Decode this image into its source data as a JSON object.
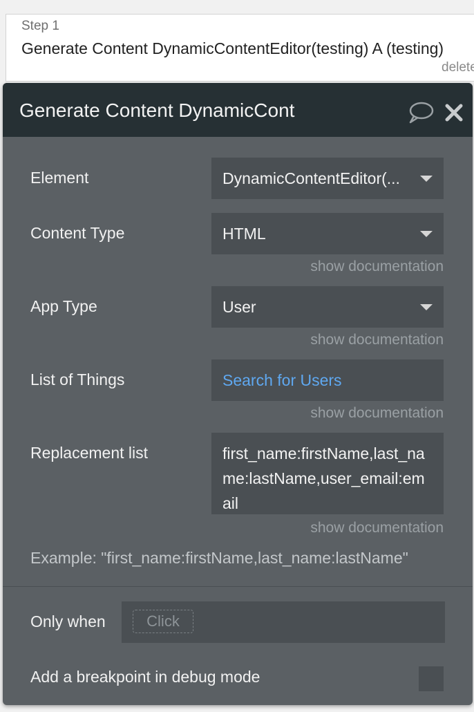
{
  "step": {
    "label": "Step 1",
    "title": "Generate Content DynamicContentEditor(testing) A (testing)",
    "delete_label": "delete"
  },
  "panel": {
    "title": "Generate Content DynamicCont",
    "header_bg": "#263034",
    "body_bg": "#5b6064",
    "field_bg": "#4a4f53",
    "link_color": "#5fa8f0"
  },
  "fields": {
    "element": {
      "label": "Element",
      "value": "DynamicContentEditor(..."
    },
    "content_type": {
      "label": "Content Type",
      "value": "HTML",
      "doc": "show documentation"
    },
    "app_type": {
      "label": "App Type",
      "value": "User",
      "doc": "show documentation"
    },
    "list_of_things": {
      "label": "List of Things",
      "value": "Search for Users",
      "doc": "show documentation"
    },
    "replacement_list": {
      "label": "Replacement list",
      "value": "first_name:firstName,last_name:lastName,user_email:email",
      "doc": "show documentation"
    }
  },
  "example": "Example: \"first_name:firstName,last_name:lastName\"",
  "only_when": {
    "label": "Only when",
    "placeholder": "Click"
  },
  "breakpoint": {
    "label": "Add a breakpoint in debug mode",
    "checked": false
  },
  "icons": {
    "comment": "comment-icon",
    "close": "close-icon"
  }
}
